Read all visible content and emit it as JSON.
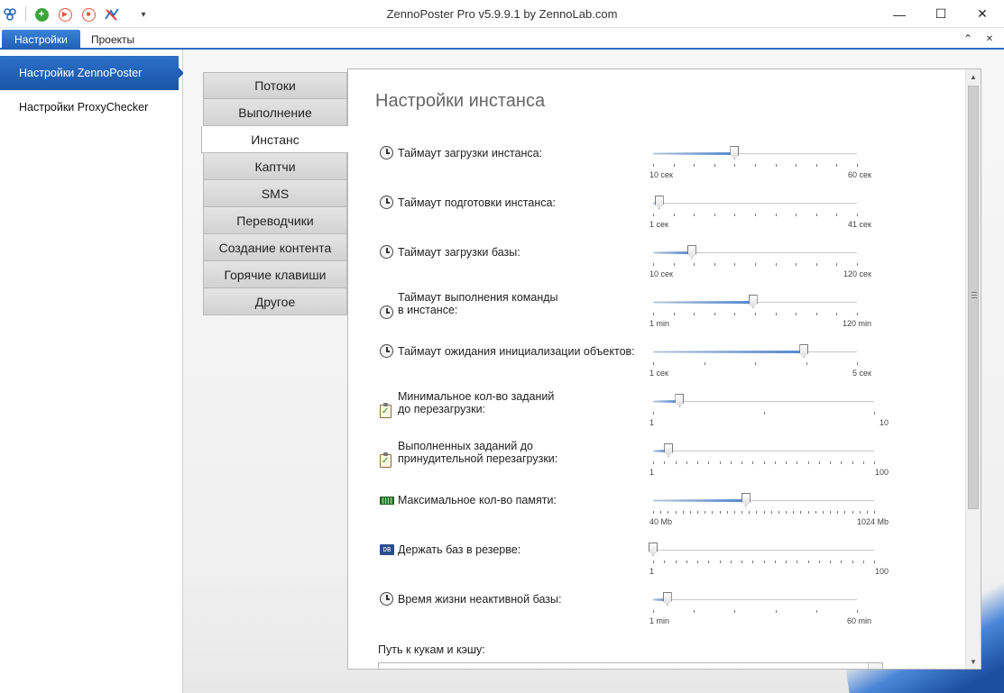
{
  "window": {
    "title": "ZennoPoster Pro v5.9.9.1 by ZennoLab.com",
    "minimize_glyph": "—",
    "maximize_glyph": "☐",
    "close_glyph": "✕"
  },
  "quick_access": {
    "icons": [
      "zennoposter-logo-icon",
      "add-task-icon",
      "start-icon",
      "stop-icon",
      "proxy-tool-icon",
      "customize-dropdown-icon"
    ],
    "add_glyph": "+",
    "play_glyph": "▶",
    "stop_glyph": "■",
    "tool_glyph": "✗",
    "dropdown_glyph": "▾"
  },
  "ribbon": {
    "tabs": [
      {
        "label": "Настройки",
        "active": true
      },
      {
        "label": "Проекты",
        "active": false
      }
    ],
    "collapse_glyph": "⌃",
    "pin_glyph": "✕"
  },
  "nav": {
    "items": [
      {
        "label": "Настройки ZennoPoster",
        "active": true
      },
      {
        "label": "Настройки ProxyChecker",
        "active": false
      }
    ]
  },
  "categories": [
    {
      "label": "Потоки",
      "active": false
    },
    {
      "label": "Выполнение",
      "active": false
    },
    {
      "label": "Инстанс",
      "active": true
    },
    {
      "label": "Каптчи",
      "active": false
    },
    {
      "label": "SMS",
      "active": false
    },
    {
      "label": "Переводчики",
      "active": false
    },
    {
      "label": "Создание контента",
      "active": false
    },
    {
      "label": "Горячие клавиши",
      "active": false
    },
    {
      "label": "Другое",
      "active": false
    }
  ],
  "panel": {
    "title": "Настройки инстанса",
    "settings": [
      {
        "label": "Таймаут загрузки инстанса:",
        "icon": "clock-icon",
        "min": "10 сек",
        "max": "60 сек",
        "value": 0.4
      },
      {
        "label": "Таймаут подготовки инстанса:",
        "icon": "clock-icon",
        "min": "1 сек",
        "max": "41 сек",
        "value": 0.03
      },
      {
        "label": "Таймаут загрузки базы:",
        "icon": "clock-icon",
        "min": "10 сек",
        "max": "120 сек",
        "value": 0.19
      },
      {
        "label": "Таймаут выполнения команды\nв инстансе:",
        "icon": "clock-icon",
        "min": "1 min",
        "max": "120 min",
        "value": 0.49
      },
      {
        "label": "Таймаут ожидания инициализации объектов:",
        "icon": "clock-icon",
        "min": "1 сек",
        "max": "5 сек",
        "value": 0.74
      },
      {
        "label": "Минимальное кол-во заданий\nдо перезагрузки:",
        "icon": "clipboard-check-icon",
        "min": "1",
        "max": "10",
        "value": 0.12
      },
      {
        "label": "Выполненных заданий до\nпринудительной перезагрузки:",
        "icon": "clipboard-check-icon",
        "min": "1",
        "max": "100",
        "value": 0.07
      },
      {
        "label": "Максимальное кол-во памяти:",
        "icon": "memory-icon",
        "min": "40 Mb",
        "max": "1024 Mb",
        "value": 0.42
      },
      {
        "label": "Держать баз в резерве:",
        "icon": "database-icon",
        "min": "1",
        "max": "100",
        "value": 0.0
      },
      {
        "label": "Время жизни неактивной базы:",
        "icon": "clock-icon",
        "min": "1 min",
        "max": "60 min",
        "value": 0.07
      }
    ],
    "path_label": "Путь к кукам и кэшу:"
  },
  "scrollbar": {
    "up_glyph": "▲",
    "down_glyph": "▼"
  },
  "colors": {
    "accent": "#2b6cc4",
    "nav_active": "#1f5fb5"
  }
}
